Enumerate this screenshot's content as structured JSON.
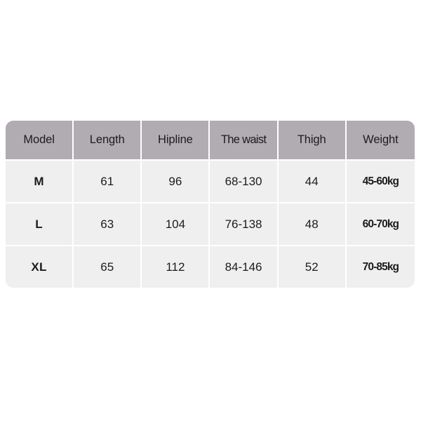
{
  "table": {
    "headers": [
      "Model",
      "Length",
      "Hipline",
      "The waist",
      "Thigh",
      "Weight"
    ],
    "rows": [
      {
        "model": "M",
        "length": "61",
        "hipline": "96",
        "waist": "68-130",
        "thigh": "44",
        "weight": "45-60kg"
      },
      {
        "model": "L",
        "length": "63",
        "hipline": "104",
        "waist": "76-138",
        "thigh": "48",
        "weight": "60-70kg"
      },
      {
        "model": "XL",
        "length": "65",
        "hipline": "112",
        "waist": "84-146",
        "thigh": "52",
        "weight": "70-85kg"
      }
    ]
  },
  "colors": {
    "header_background": "#b0acb2",
    "cell_background": "#efefef",
    "divider": "#ffffff",
    "text": "#1c1c1c",
    "page_background": "#ffffff"
  }
}
